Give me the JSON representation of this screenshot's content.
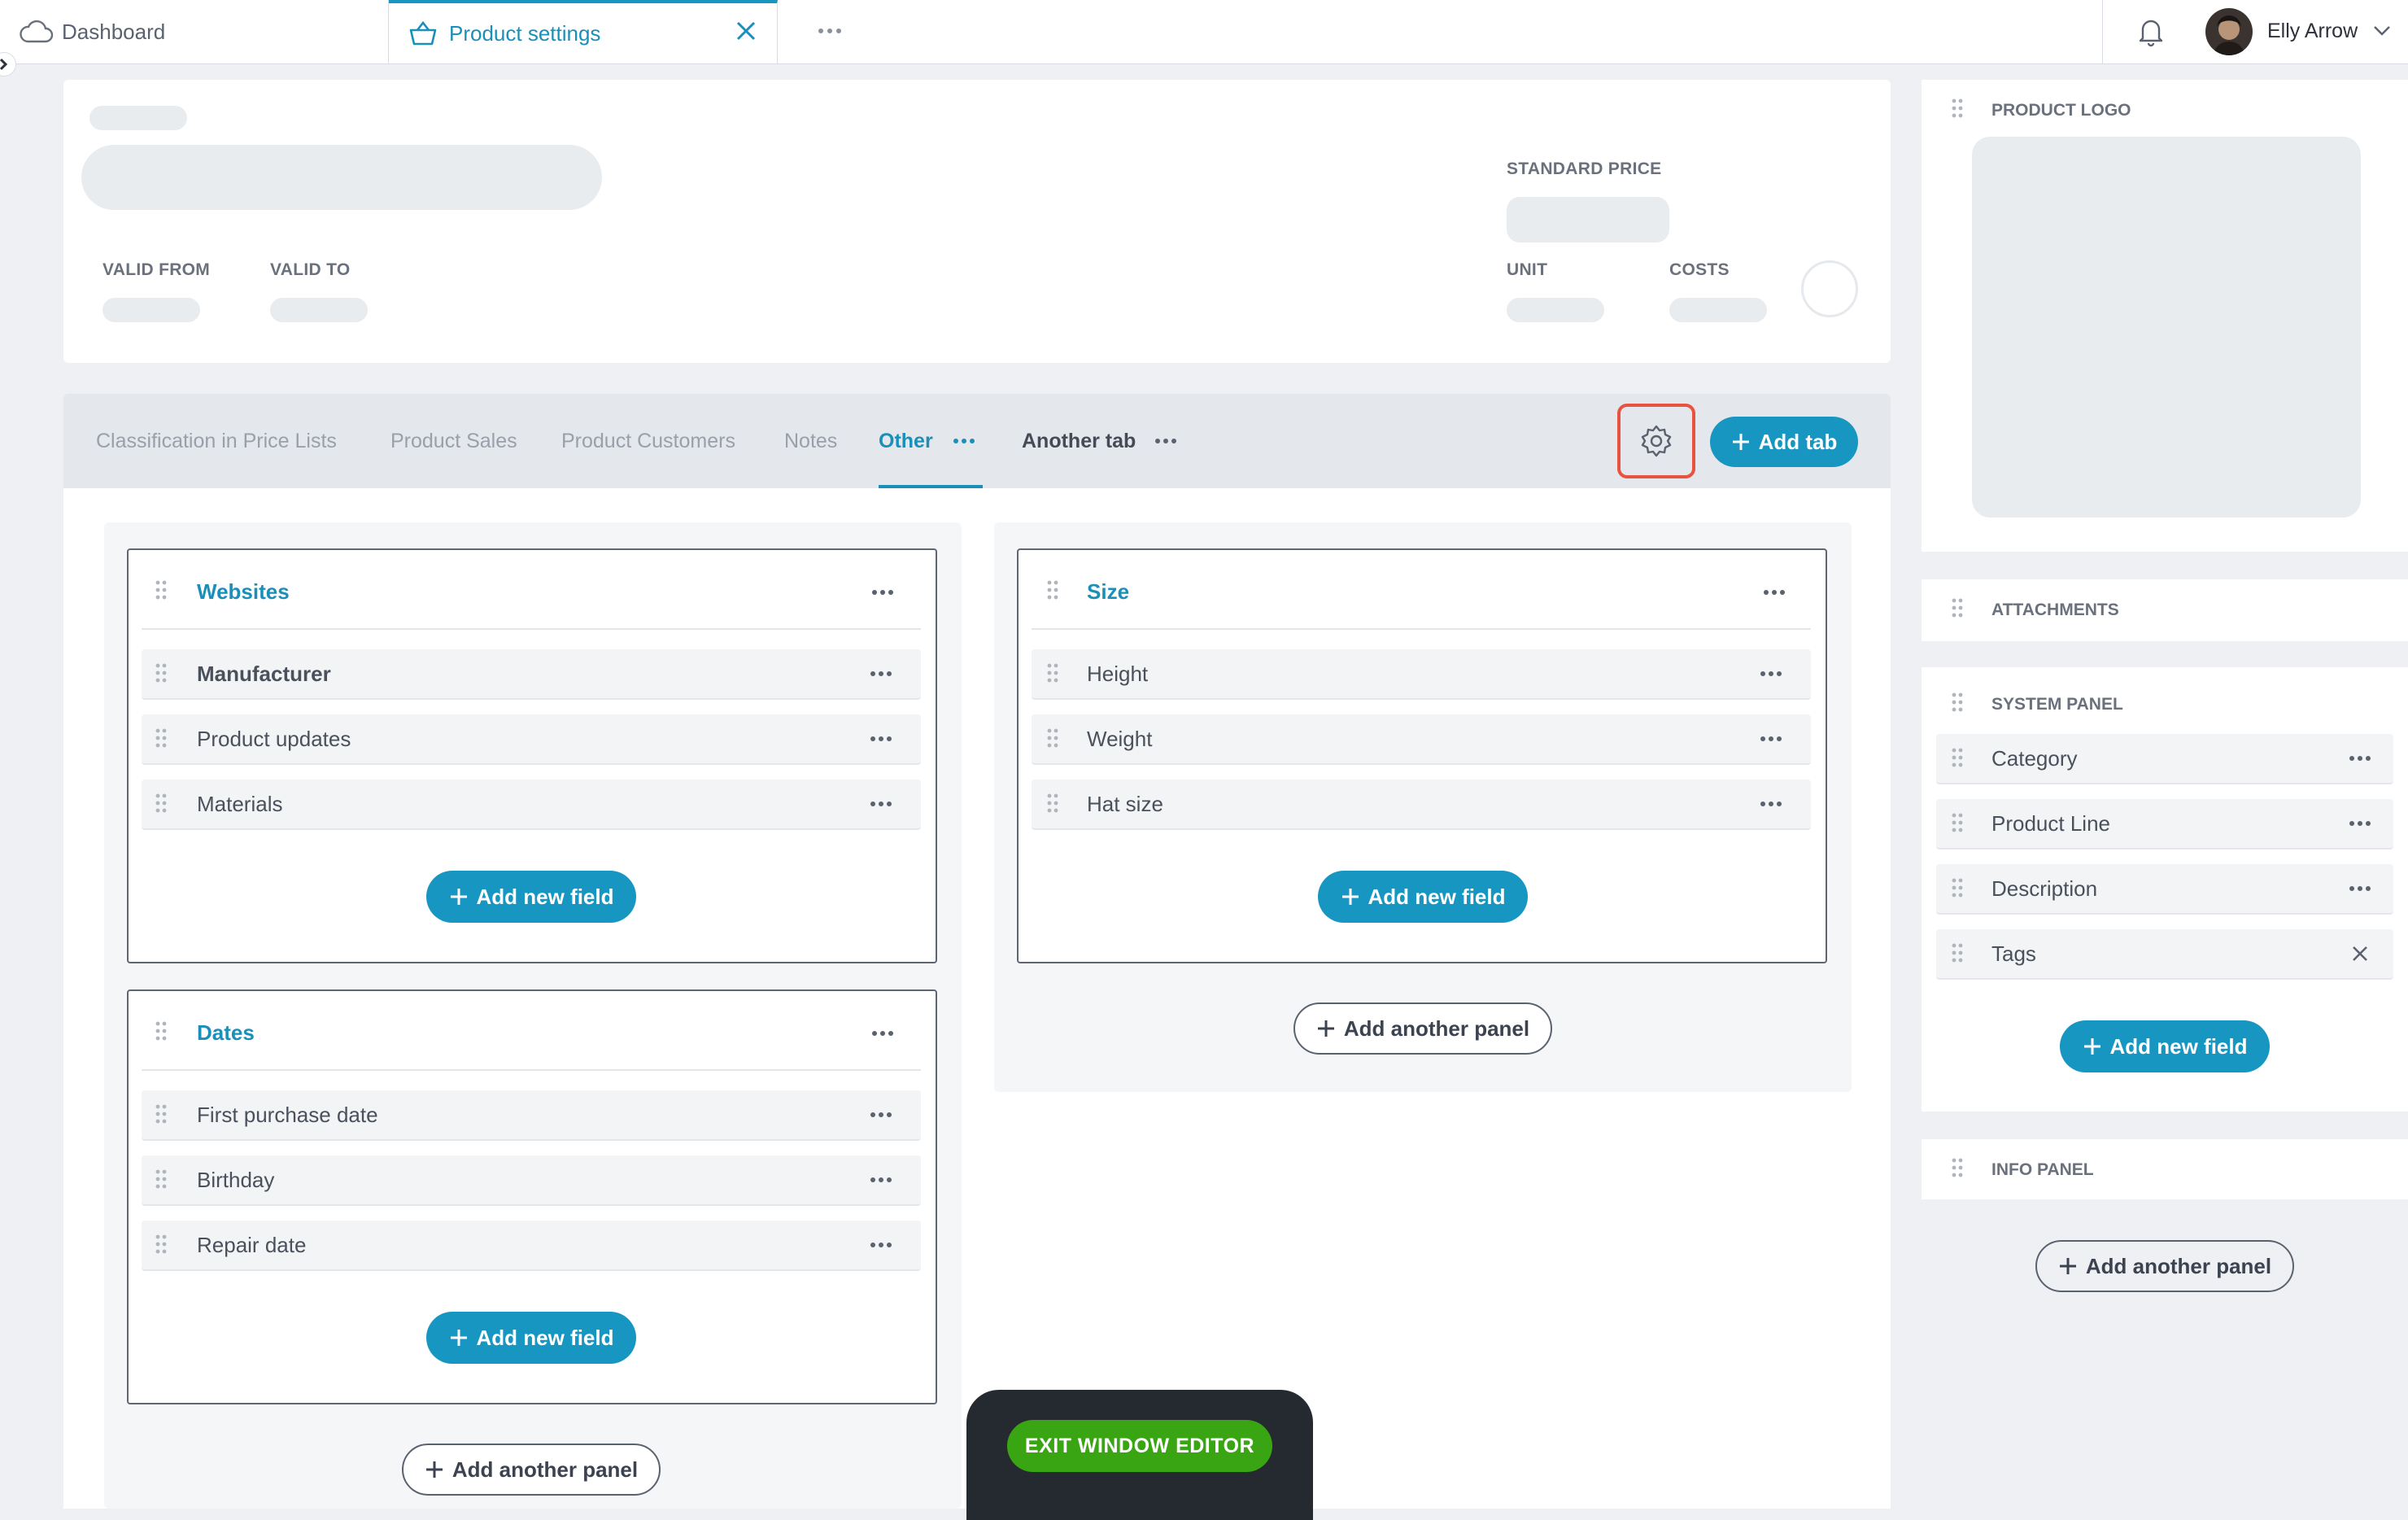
{
  "top_tabs": {
    "dashboard": "Dashboard",
    "product_settings": "Product settings"
  },
  "user": {
    "name": "Elly Arrow"
  },
  "header": {
    "valid_from": "VALID FROM",
    "valid_to": "VALID TO",
    "standard_price": "STANDARD PRICE",
    "unit": "UNIT",
    "costs": "COSTS"
  },
  "product_tabs": [
    "Classification in Price Lists",
    "Product Sales",
    "Product Customers",
    "Notes",
    "Other",
    "Another tab"
  ],
  "active_tab": "Other",
  "add_tab_label": "Add tab",
  "panels": {
    "websites": {
      "title": "Websites",
      "fields": [
        "Manufacturer",
        "Product updates",
        "Materials"
      ],
      "add_field": "Add new field"
    },
    "dates": {
      "title": "Dates",
      "fields": [
        "First purchase date",
        "Birthday",
        "Repair date"
      ],
      "add_field": "Add new field"
    },
    "size": {
      "title": "Size",
      "fields": [
        "Height",
        "Weight",
        "Hat size"
      ],
      "add_field": "Add new field"
    }
  },
  "add_another_panel": "Add another panel",
  "right_column": {
    "product_logo": "PRODUCT LOGO",
    "attachments": "ATTACHMENTS",
    "system_panel": {
      "title": "SYSTEM PANEL",
      "fields": [
        "Category",
        "Product Line",
        "Description",
        "Tags"
      ],
      "add_field": "Add new field"
    },
    "info_panel": "INFO PANEL",
    "add_another_panel": "Add another panel"
  },
  "exit_editor": "EXIT WINDOW EDITOR",
  "colors": {
    "accent": "#1796c2",
    "exit_green": "#3aa512",
    "highlight_red": "#e8533f"
  }
}
